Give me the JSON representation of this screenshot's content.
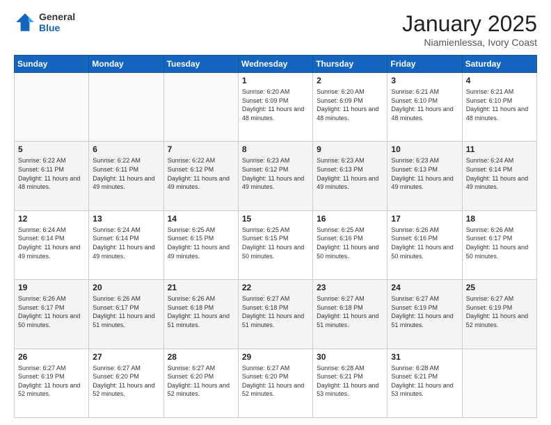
{
  "header": {
    "logo_general": "General",
    "logo_blue": "Blue",
    "month_title": "January 2025",
    "location": "Niamienlessa, Ivory Coast"
  },
  "days_of_week": [
    "Sunday",
    "Monday",
    "Tuesday",
    "Wednesday",
    "Thursday",
    "Friday",
    "Saturday"
  ],
  "weeks": [
    [
      {
        "day": "",
        "info": ""
      },
      {
        "day": "",
        "info": ""
      },
      {
        "day": "",
        "info": ""
      },
      {
        "day": "1",
        "info": "Sunrise: 6:20 AM\nSunset: 6:09 PM\nDaylight: 11 hours and 48 minutes."
      },
      {
        "day": "2",
        "info": "Sunrise: 6:20 AM\nSunset: 6:09 PM\nDaylight: 11 hours and 48 minutes."
      },
      {
        "day": "3",
        "info": "Sunrise: 6:21 AM\nSunset: 6:10 PM\nDaylight: 11 hours and 48 minutes."
      },
      {
        "day": "4",
        "info": "Sunrise: 6:21 AM\nSunset: 6:10 PM\nDaylight: 11 hours and 48 minutes."
      }
    ],
    [
      {
        "day": "5",
        "info": "Sunrise: 6:22 AM\nSunset: 6:11 PM\nDaylight: 11 hours and 48 minutes."
      },
      {
        "day": "6",
        "info": "Sunrise: 6:22 AM\nSunset: 6:11 PM\nDaylight: 11 hours and 49 minutes."
      },
      {
        "day": "7",
        "info": "Sunrise: 6:22 AM\nSunset: 6:12 PM\nDaylight: 11 hours and 49 minutes."
      },
      {
        "day": "8",
        "info": "Sunrise: 6:23 AM\nSunset: 6:12 PM\nDaylight: 11 hours and 49 minutes."
      },
      {
        "day": "9",
        "info": "Sunrise: 6:23 AM\nSunset: 6:13 PM\nDaylight: 11 hours and 49 minutes."
      },
      {
        "day": "10",
        "info": "Sunrise: 6:23 AM\nSunset: 6:13 PM\nDaylight: 11 hours and 49 minutes."
      },
      {
        "day": "11",
        "info": "Sunrise: 6:24 AM\nSunset: 6:14 PM\nDaylight: 11 hours and 49 minutes."
      }
    ],
    [
      {
        "day": "12",
        "info": "Sunrise: 6:24 AM\nSunset: 6:14 PM\nDaylight: 11 hours and 49 minutes."
      },
      {
        "day": "13",
        "info": "Sunrise: 6:24 AM\nSunset: 6:14 PM\nDaylight: 11 hours and 49 minutes."
      },
      {
        "day": "14",
        "info": "Sunrise: 6:25 AM\nSunset: 6:15 PM\nDaylight: 11 hours and 49 minutes."
      },
      {
        "day": "15",
        "info": "Sunrise: 6:25 AM\nSunset: 6:15 PM\nDaylight: 11 hours and 50 minutes."
      },
      {
        "day": "16",
        "info": "Sunrise: 6:25 AM\nSunset: 6:16 PM\nDaylight: 11 hours and 50 minutes."
      },
      {
        "day": "17",
        "info": "Sunrise: 6:26 AM\nSunset: 6:16 PM\nDaylight: 11 hours and 50 minutes."
      },
      {
        "day": "18",
        "info": "Sunrise: 6:26 AM\nSunset: 6:17 PM\nDaylight: 11 hours and 50 minutes."
      }
    ],
    [
      {
        "day": "19",
        "info": "Sunrise: 6:26 AM\nSunset: 6:17 PM\nDaylight: 11 hours and 50 minutes."
      },
      {
        "day": "20",
        "info": "Sunrise: 6:26 AM\nSunset: 6:17 PM\nDaylight: 11 hours and 51 minutes."
      },
      {
        "day": "21",
        "info": "Sunrise: 6:26 AM\nSunset: 6:18 PM\nDaylight: 11 hours and 51 minutes."
      },
      {
        "day": "22",
        "info": "Sunrise: 6:27 AM\nSunset: 6:18 PM\nDaylight: 11 hours and 51 minutes."
      },
      {
        "day": "23",
        "info": "Sunrise: 6:27 AM\nSunset: 6:18 PM\nDaylight: 11 hours and 51 minutes."
      },
      {
        "day": "24",
        "info": "Sunrise: 6:27 AM\nSunset: 6:19 PM\nDaylight: 11 hours and 51 minutes."
      },
      {
        "day": "25",
        "info": "Sunrise: 6:27 AM\nSunset: 6:19 PM\nDaylight: 11 hours and 52 minutes."
      }
    ],
    [
      {
        "day": "26",
        "info": "Sunrise: 6:27 AM\nSunset: 6:19 PM\nDaylight: 11 hours and 52 minutes."
      },
      {
        "day": "27",
        "info": "Sunrise: 6:27 AM\nSunset: 6:20 PM\nDaylight: 11 hours and 52 minutes."
      },
      {
        "day": "28",
        "info": "Sunrise: 6:27 AM\nSunset: 6:20 PM\nDaylight: 11 hours and 52 minutes."
      },
      {
        "day": "29",
        "info": "Sunrise: 6:27 AM\nSunset: 6:20 PM\nDaylight: 11 hours and 52 minutes."
      },
      {
        "day": "30",
        "info": "Sunrise: 6:28 AM\nSunset: 6:21 PM\nDaylight: 11 hours and 53 minutes."
      },
      {
        "day": "31",
        "info": "Sunrise: 6:28 AM\nSunset: 6:21 PM\nDaylight: 11 hours and 53 minutes."
      },
      {
        "day": "",
        "info": ""
      }
    ]
  ]
}
